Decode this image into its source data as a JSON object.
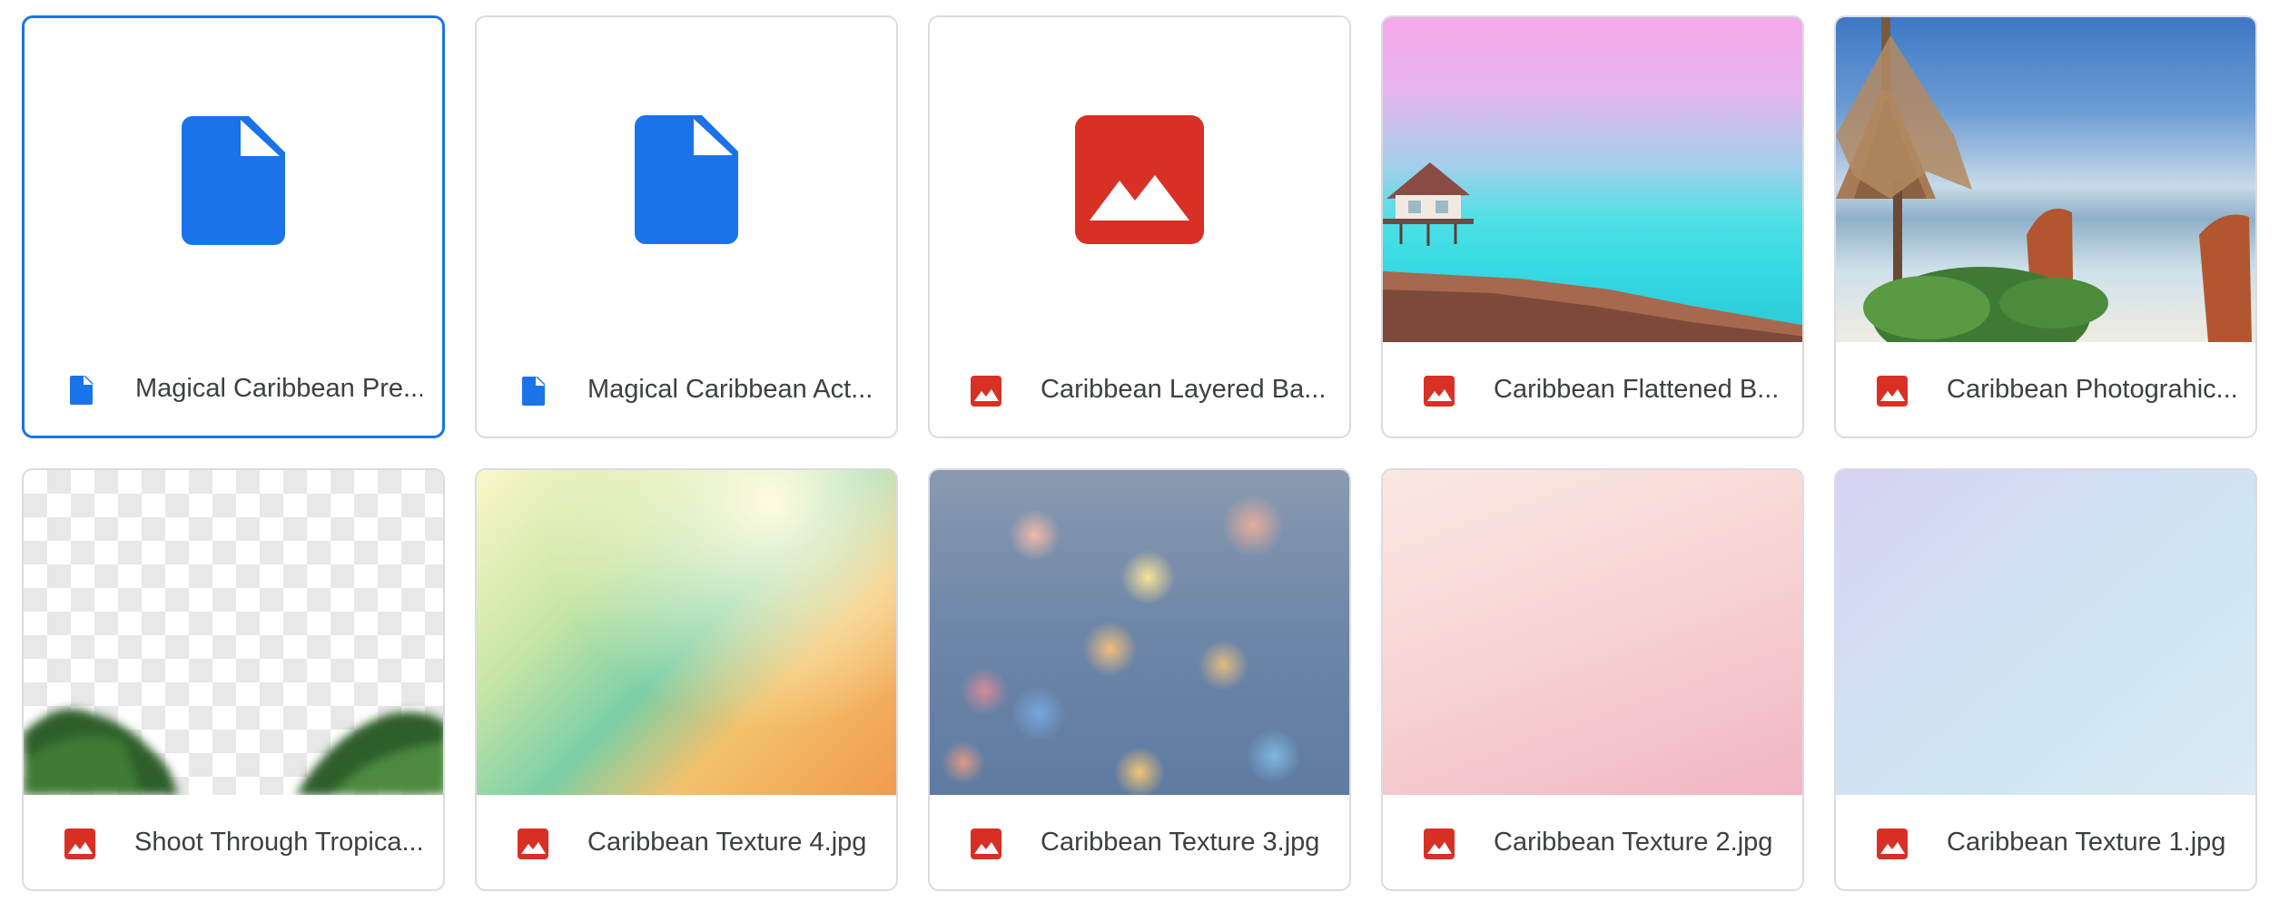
{
  "colors": {
    "doc_blue": "#1a73e8",
    "image_red": "#d93025",
    "selected_border": "#1a73e8",
    "card_border": "#dadce0",
    "label_text": "#3c4043"
  },
  "files": [
    {
      "name": "Magical Caribbean Pre...",
      "type": "document",
      "icon": "document-icon",
      "preview": "document-icon",
      "selected": true
    },
    {
      "name": "Magical Caribbean Act...",
      "type": "document",
      "icon": "document-icon",
      "preview": "document-icon",
      "selected": false
    },
    {
      "name": "Caribbean Layered Ba...",
      "type": "image",
      "icon": "image-icon",
      "preview": "image-icon",
      "selected": false
    },
    {
      "name": "Caribbean Flattened B...",
      "type": "image",
      "icon": "image-icon",
      "preview": "thumbnail",
      "selected": false
    },
    {
      "name": "Caribbean Photograhic...",
      "type": "image",
      "icon": "image-icon",
      "preview": "thumbnail",
      "selected": false
    },
    {
      "name": "Shoot Through Tropica...",
      "type": "image",
      "icon": "image-icon",
      "preview": "thumbnail",
      "selected": false
    },
    {
      "name": "Caribbean Texture 4.jpg",
      "type": "image",
      "icon": "image-icon",
      "preview": "thumbnail",
      "selected": false
    },
    {
      "name": "Caribbean Texture 3.jpg",
      "type": "image",
      "icon": "image-icon",
      "preview": "thumbnail",
      "selected": false
    },
    {
      "name": "Caribbean Texture 2.jpg",
      "type": "image",
      "icon": "image-icon",
      "preview": "thumbnail",
      "selected": false
    },
    {
      "name": "Caribbean Texture 1.jpg",
      "type": "image",
      "icon": "image-icon",
      "preview": "thumbnail",
      "selected": false
    }
  ]
}
